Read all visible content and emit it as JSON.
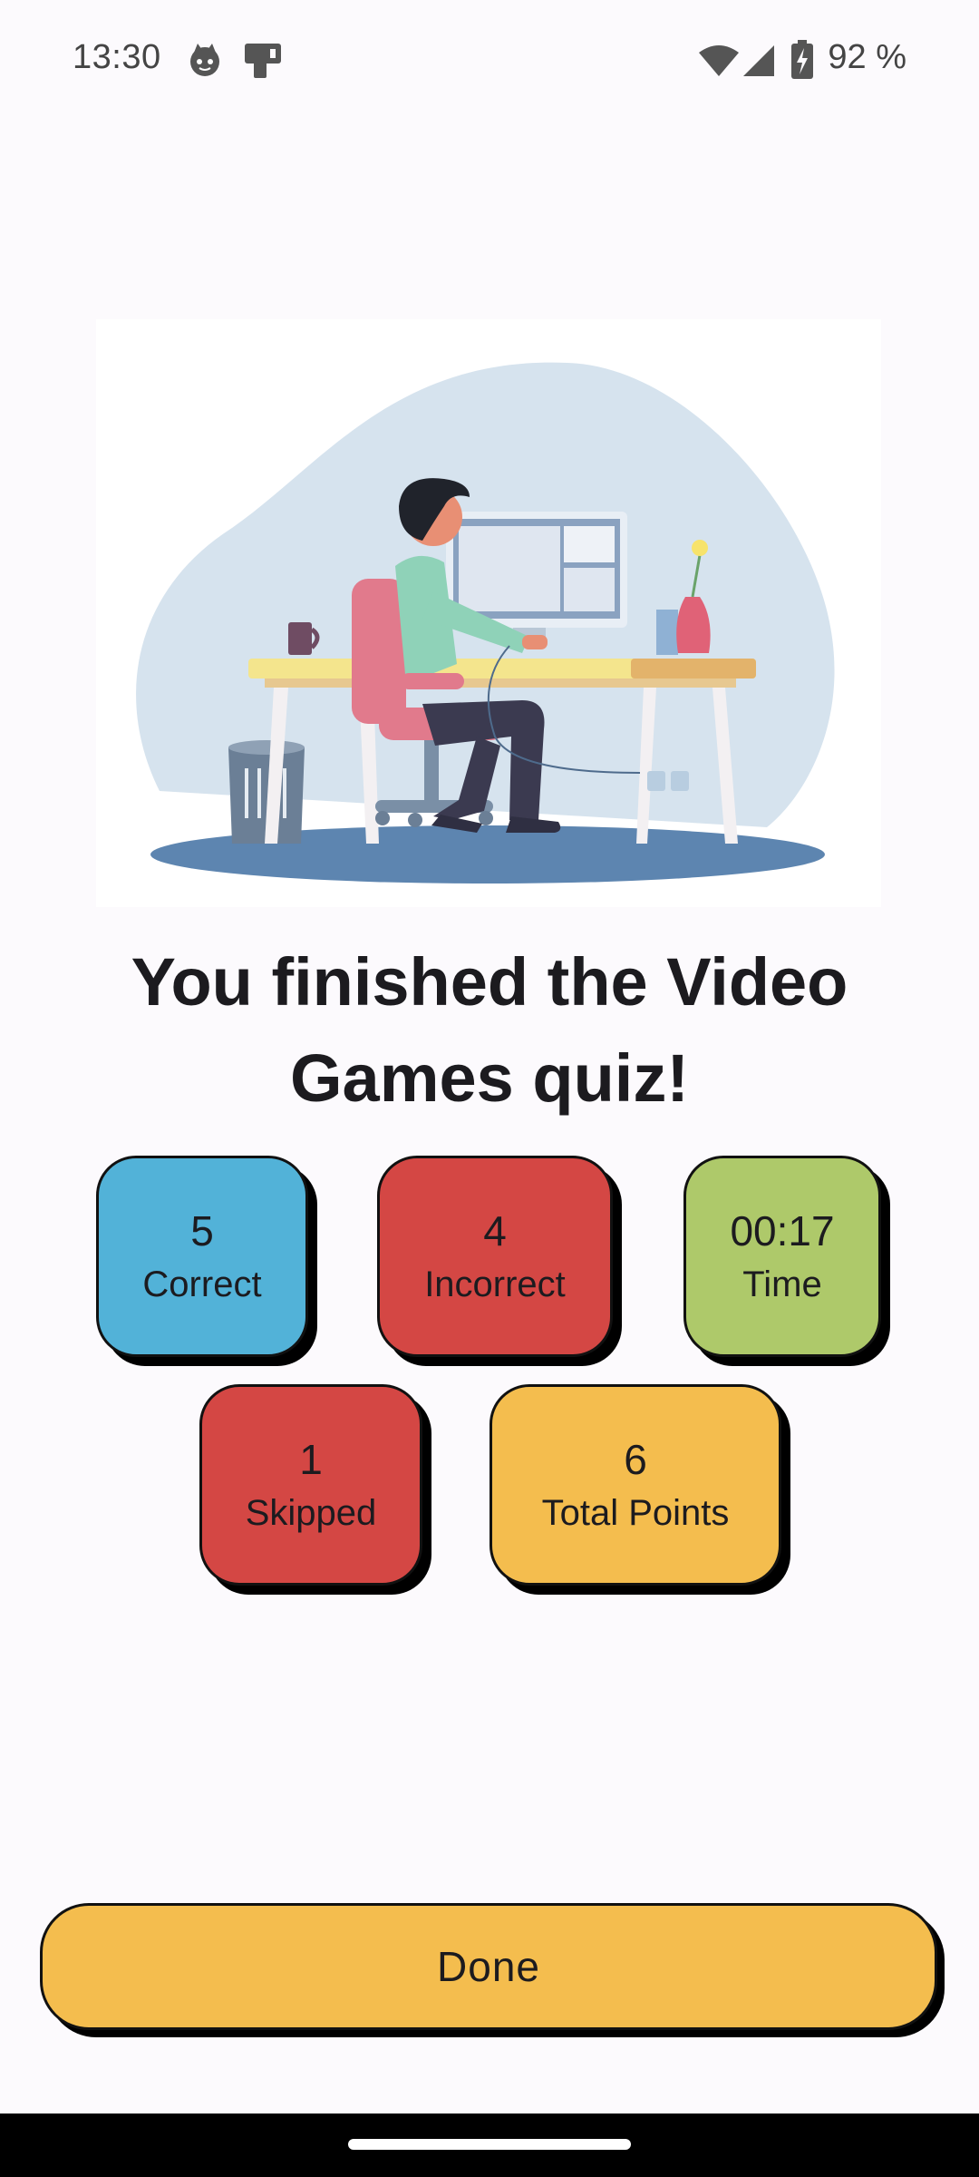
{
  "status_bar": {
    "time": "13:30",
    "battery": "92 %",
    "icons": [
      "cat-notification-icon",
      "device-notification-icon",
      "wifi-icon",
      "signal-icon",
      "battery-charging-icon"
    ]
  },
  "illustration": {
    "name": "person-at-desk-illustration"
  },
  "heading": "You finished the Video Games quiz!",
  "stats": {
    "correct": {
      "value": "5",
      "label": "Correct",
      "color": "#52b2d8"
    },
    "incorrect": {
      "value": "4",
      "label": "Incorrect",
      "color": "#d44744"
    },
    "time": {
      "value": "00:17",
      "label": "Time",
      "color": "#aec96a"
    },
    "skipped": {
      "value": "1",
      "label": "Skipped",
      "color": "#d44744"
    },
    "total_points": {
      "value": "6",
      "label": "Total Points",
      "color": "#f4bd4e"
    }
  },
  "done_button": {
    "label": "Done",
    "color": "#f4bd4e"
  }
}
